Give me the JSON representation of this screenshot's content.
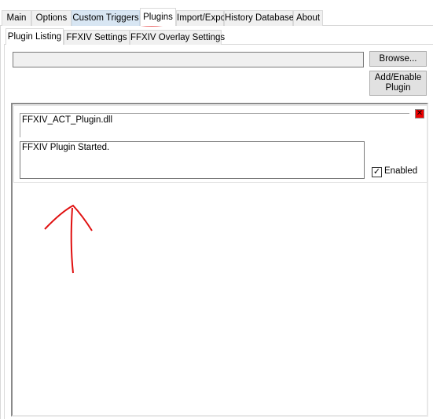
{
  "main_tabs": [
    "Main",
    "Options",
    "Custom Triggers",
    "Plugins",
    "Import/Export",
    "History Database",
    "About"
  ],
  "selected_main_tab": "Plugins",
  "sub_tabs": [
    "Plugin Listing",
    "FFXIV Settings",
    "FFXIV Overlay Settings"
  ],
  "selected_sub_tab": "Plugin Listing",
  "plugin_path": {
    "value": ""
  },
  "buttons": {
    "browse": "Browse...",
    "add_enable": "Add/Enable Plugin"
  },
  "plugin": {
    "file_name": "FFXIV_ACT_Plugin.dll",
    "status": "FFXIV Plugin Started.",
    "enabled_label": "Enabled",
    "enabled": true
  },
  "annotation_color": "#e01010"
}
